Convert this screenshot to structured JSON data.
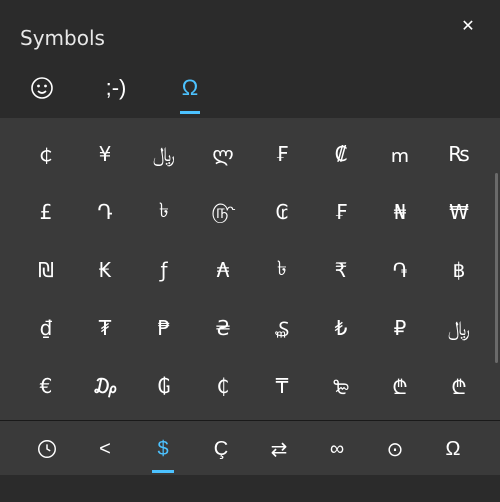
{
  "header": {
    "title": "Symbols",
    "close_label": "✕"
  },
  "tabs": {
    "emoji_icon": "☺",
    "kaomoji_label": ";-)",
    "symbols_label": "Ω"
  },
  "symbol_grid": [
    [
      "￠",
      "¥",
      "﷼",
      "ლ",
      "₣",
      "₡",
      "ՠ",
      "₨"
    ],
    [
      "£",
      "Դ",
      "৳",
      "௹",
      "₢",
      "₣",
      "₦",
      "₩"
    ],
    [
      "₪",
      "₭",
      "ƒ",
      "₳",
      "৳",
      "₹",
      "֏",
      "฿"
    ],
    [
      "₫",
      "₮",
      "₱",
      "₴",
      "₷",
      "₺",
      "₽",
      "﷼"
    ],
    [
      "€",
      "₯",
      "₲",
      "₵",
      "₸",
      "₻",
      "₾",
      "₾"
    ]
  ],
  "footer": {
    "recent": "⟳",
    "less_than": "<",
    "currency": "$",
    "latin": "Ç",
    "arrows": "⇄",
    "infinity": "∞",
    "circled": "⊙",
    "greek": "Ω"
  }
}
